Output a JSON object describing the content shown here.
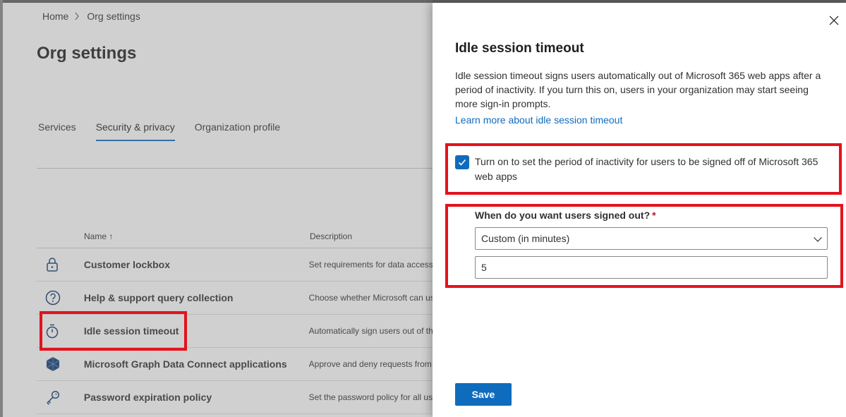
{
  "breadcrumb": {
    "home": "Home",
    "current": "Org settings"
  },
  "page": {
    "title": "Org settings"
  },
  "tabs": [
    {
      "label": "Services"
    },
    {
      "label": "Security & privacy",
      "active": true
    },
    {
      "label": "Organization profile"
    }
  ],
  "table": {
    "headers": {
      "name": "Name ↑",
      "description": "Description"
    },
    "rows": [
      {
        "icon": "lock-icon",
        "name": "Customer lockbox",
        "description": "Set requirements for data access."
      },
      {
        "icon": "help-circle-icon",
        "name": "Help & support query collection",
        "description": "Choose whether Microsoft can us"
      },
      {
        "icon": "timer-icon",
        "name": "Idle session timeout",
        "description": "Automatically sign users out of th"
      },
      {
        "icon": "graph-data-connect-icon",
        "name": "Microsoft Graph Data Connect applications",
        "description": "Approve and deny requests from"
      },
      {
        "icon": "key-icon",
        "name": "Password expiration policy",
        "description": "Set the password policy for all us"
      }
    ]
  },
  "panel": {
    "title": "Idle session timeout",
    "description": "Idle session timeout signs users automatically out of Microsoft 365 web apps after a period of inactivity. If you turn this on, users in your organization may start seeing more sign-in prompts.",
    "learn_more": "Learn more about idle session timeout",
    "checkbox_label": "Turn on to set the period of inactivity for users to be signed off of Microsoft 365 web apps",
    "checkbox_checked": true,
    "question_label": "When do you want users signed out?",
    "required_mark": "*",
    "select_value": "Custom (in minutes)",
    "minutes_value": "5",
    "save_label": "Save"
  },
  "colors": {
    "accent": "#0f6cbd",
    "highlight": "#e3121e"
  }
}
